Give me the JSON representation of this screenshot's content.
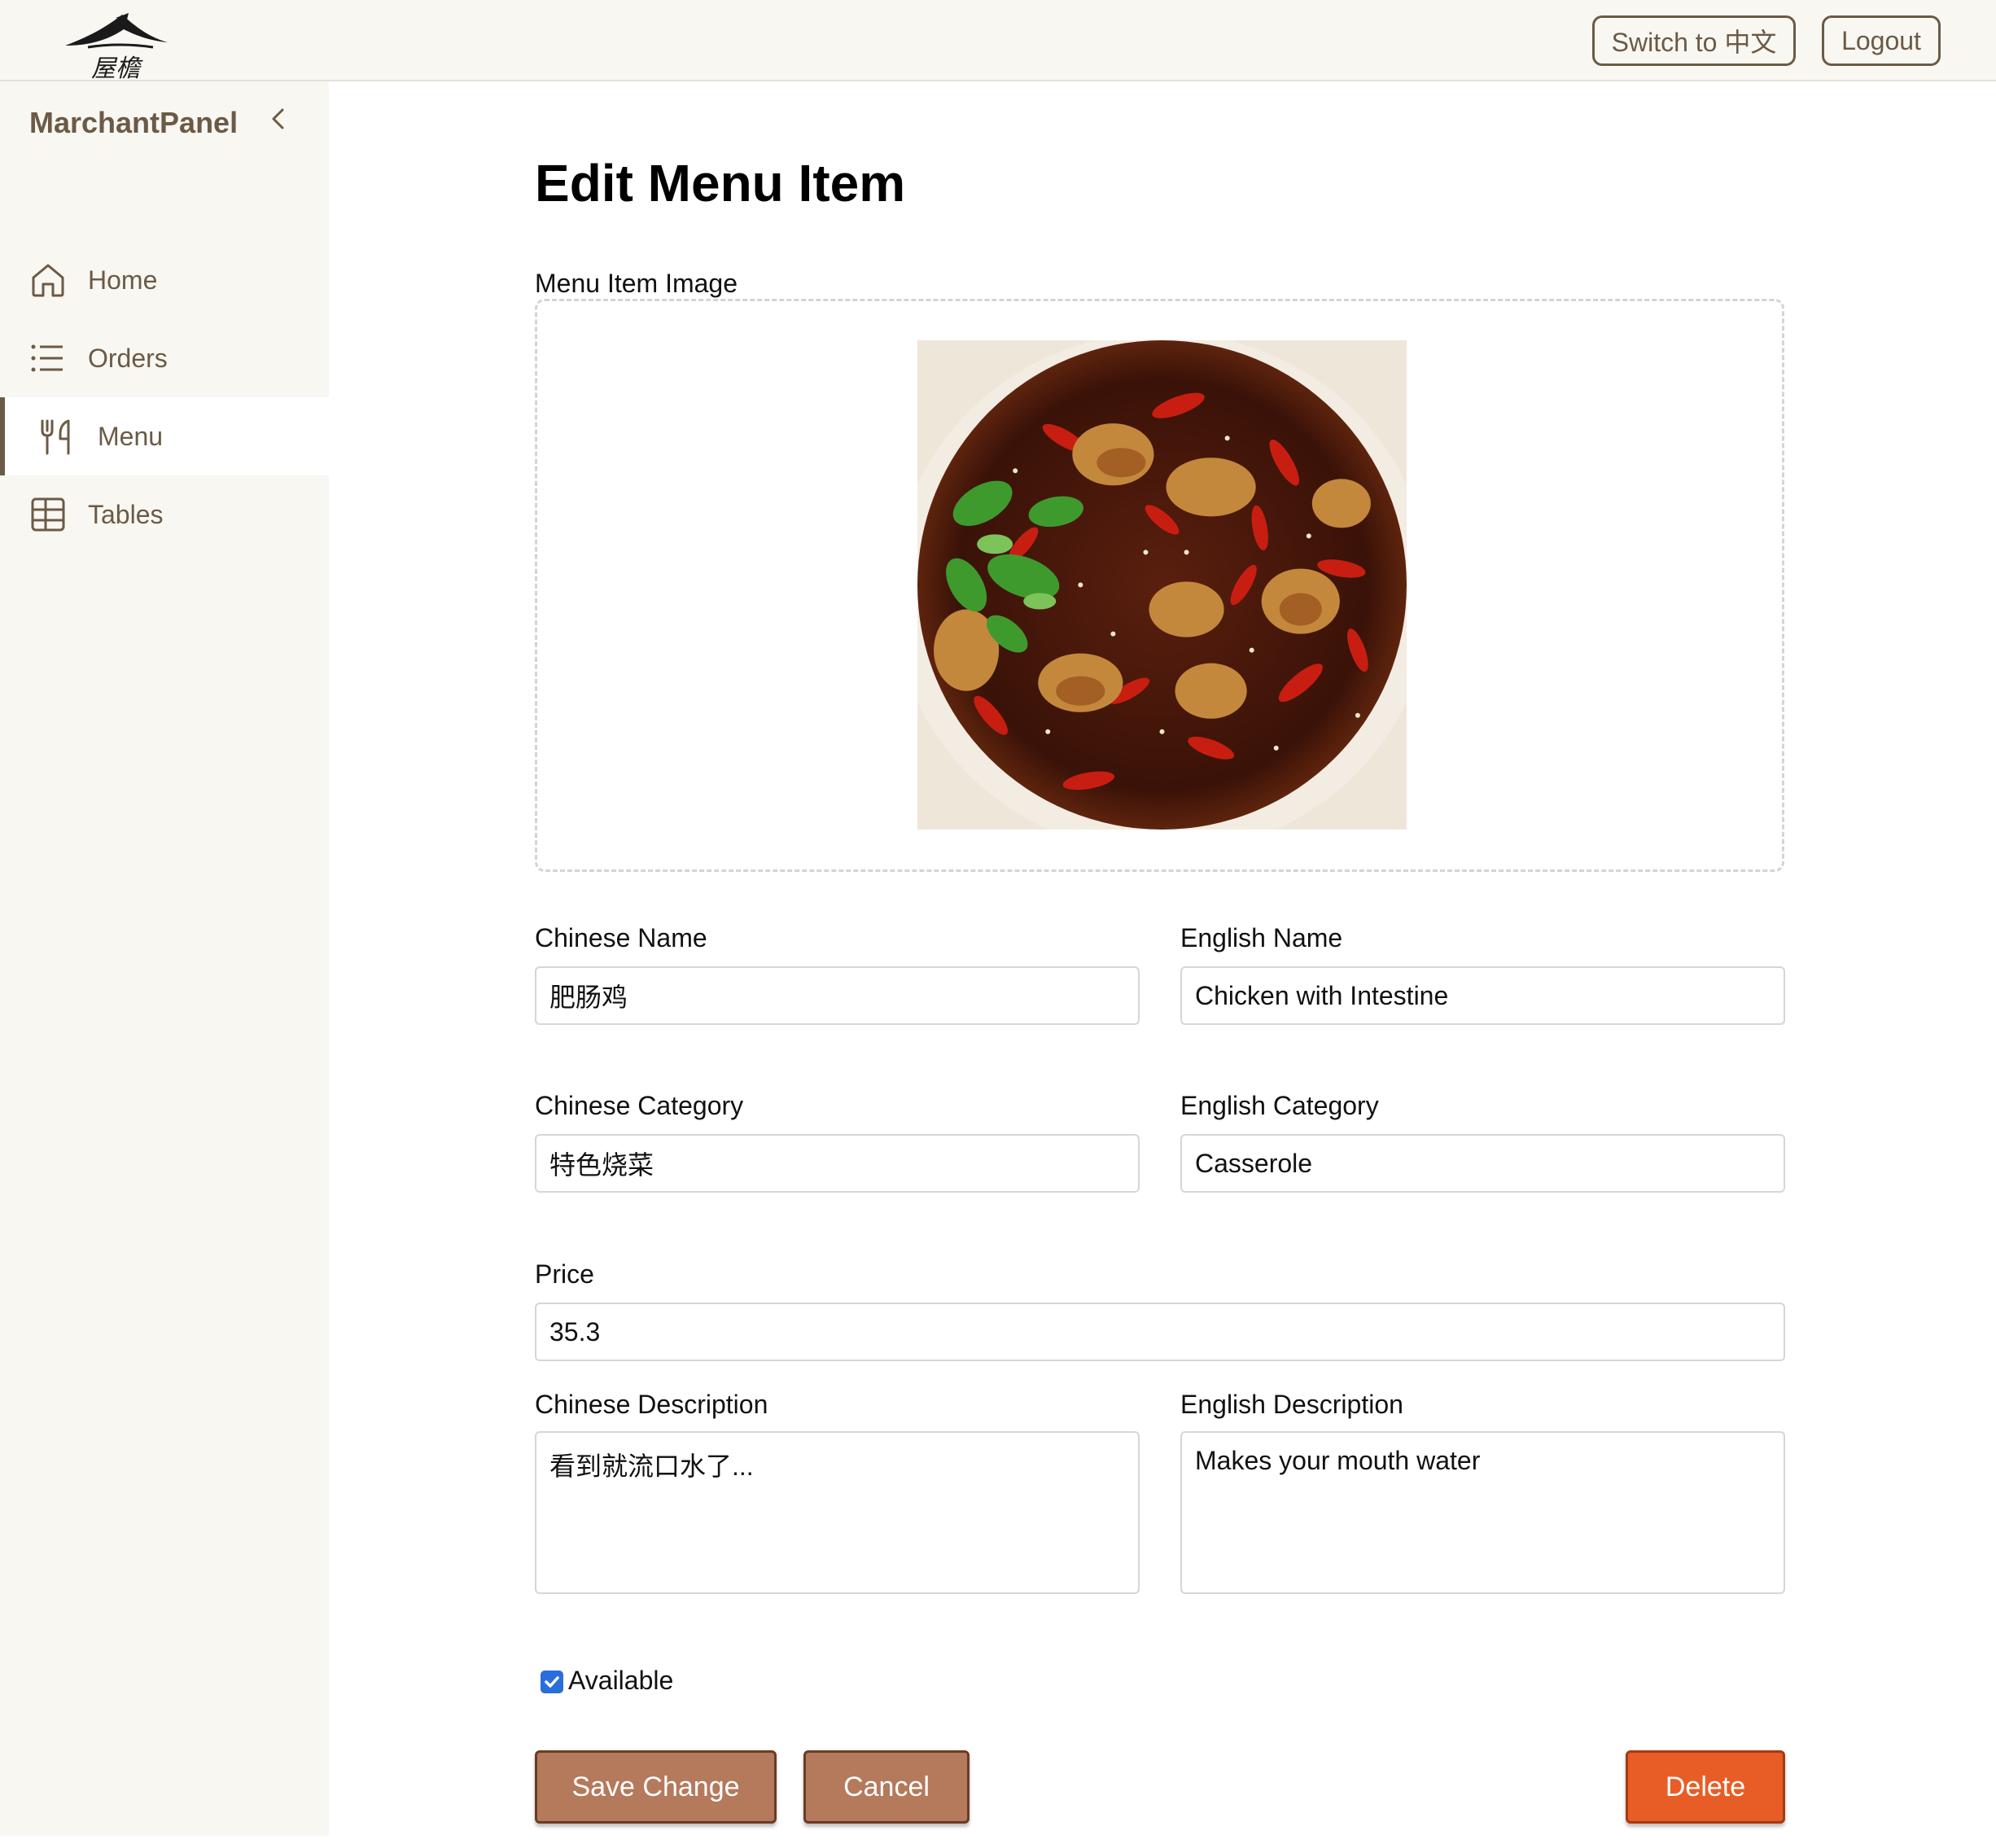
{
  "header": {
    "logo_text": "屋檐",
    "switch_lang_label": "Switch to 中文",
    "logout_label": "Logout"
  },
  "sidebar": {
    "brand": "MarchantPanel",
    "collapse_icon": "chevron-left-icon",
    "items": [
      {
        "label": "Home",
        "icon": "home-icon",
        "active": false
      },
      {
        "label": "Orders",
        "icon": "list-icon",
        "active": false
      },
      {
        "label": "Menu",
        "icon": "utensils-icon",
        "active": true
      },
      {
        "label": "Tables",
        "icon": "table-icon",
        "active": false
      }
    ]
  },
  "form": {
    "title": "Edit Menu Item",
    "image_label": "Menu Item Image",
    "chinese_name_label": "Chinese Name",
    "chinese_name_value": "肥肠鸡",
    "english_name_label": "English Name",
    "english_name_value": "Chicken with Intestine",
    "chinese_category_label": "Chinese Category",
    "chinese_category_value": "特色烧菜",
    "english_category_label": "English Category",
    "english_category_value": "Casserole",
    "price_label": "Price",
    "price_value": "35.3",
    "chinese_description_label": "Chinese Description",
    "chinese_description_value": "看到就流口水了...",
    "english_description_label": "English Description",
    "english_description_value": "Makes your mouth water",
    "available_label": "Available",
    "available_checked": true
  },
  "actions": {
    "save_label": "Save Change",
    "cancel_label": "Cancel",
    "delete_label": "Delete"
  },
  "colors": {
    "accent_brown": "#6b5a45",
    "button_brown": "#b5795c",
    "delete_orange": "#e85d26",
    "sidebar_bg": "#f9f7f2"
  }
}
